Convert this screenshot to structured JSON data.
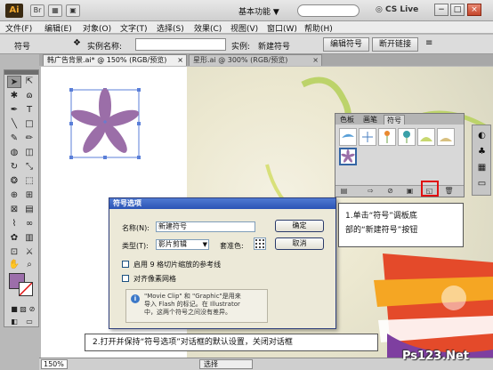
{
  "titlebar": {
    "logo": "Ai",
    "workspace": "基本功能",
    "workspace_arrow": "▼",
    "cs_live": "CS Live",
    "window_minimize": "−",
    "window_restore": "□",
    "window_close": "×"
  },
  "menubar": {
    "items": [
      "文件(F)",
      "编辑(E)",
      "对象(O)",
      "文字(T)",
      "选择(S)",
      "效果(C)",
      "视图(V)",
      "窗口(W)",
      "帮助(H)"
    ]
  },
  "control_bar": {
    "symbol_label": "符号",
    "instance_name_label": "实例名称:",
    "instance_name_value": "",
    "instance_label": "实例:",
    "instance_value": "新建符号",
    "edit_symbol_button": "编辑符号",
    "break_link_button": "断开链接"
  },
  "document_tabs": [
    {
      "label": "韩广告背景.ai* @ 150% (RGB/预览)",
      "close": "×"
    },
    {
      "label": "星形.ai @ 300% (RGB/预览)",
      "close": "×"
    }
  ],
  "symbols_panel": {
    "tabs": [
      "色板",
      "画笔",
      "符号"
    ],
    "active_tab": "符号"
  },
  "dialog": {
    "title": "符号选项",
    "name_label": "名称(N):",
    "name_value": "新建符号",
    "type_label": "类型(T):",
    "type_value": "影片剪辑",
    "registration_label": "套准色:",
    "ok_button": "确定",
    "cancel_button": "取消",
    "enable_9slice": "启用 9 格切片缩放的参考线",
    "align_pixel_grid": "对齐像素网格",
    "info_line1": "\"Movie Clip\" 和 \"Graphic\"是用来",
    "info_line2": "导入 Flash 的标记。在 Illustrator",
    "info_line3": "中，这两个符号之间没有差异。"
  },
  "callouts": {
    "top_line1": "1.单击“符号”调板底",
    "top_line2": "部的“新建符号”按钮",
    "bottom": "2.打开并保持“符号选项”对话框的默认设置，关闭对话框"
  },
  "status_bar": {
    "zoom": "150%",
    "selection": "选择"
  },
  "watermark": "Ps123.Net",
  "colors": {
    "fill": "#9c6eaa",
    "flower": "#9b6ea8",
    "highlight": "#e01010",
    "dialog_title": "#2b54b5"
  }
}
